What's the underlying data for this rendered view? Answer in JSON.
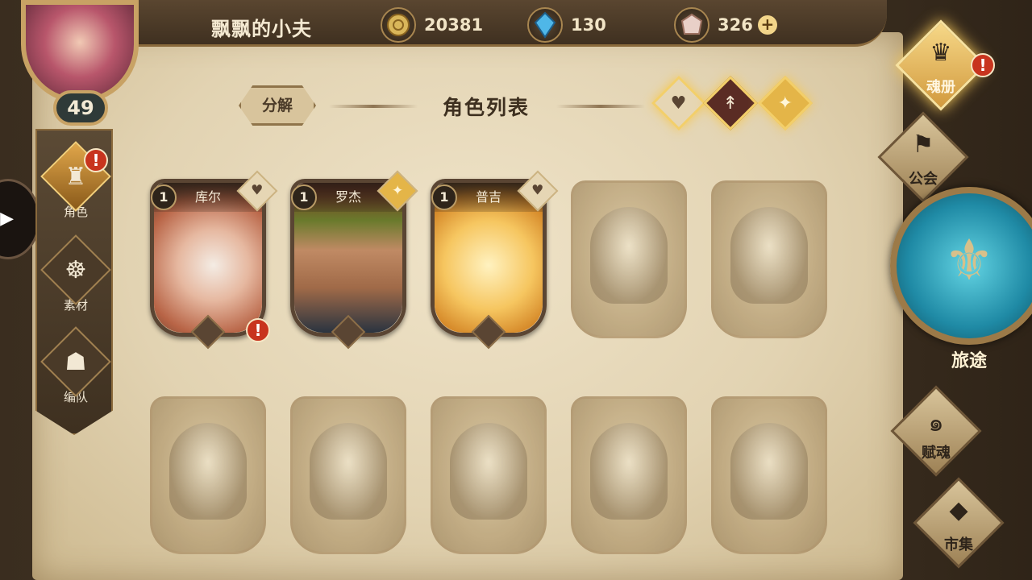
{
  "player": {
    "name": "飘飘的小夫",
    "level": "49"
  },
  "resources": [
    {
      "icon": "gold-coin-icon",
      "value": "20381",
      "has_plus": false
    },
    {
      "icon": "blue-crystal-icon",
      "value": "130",
      "has_plus": false
    },
    {
      "icon": "rainbow-gem-icon",
      "value": "326",
      "has_plus": true
    }
  ],
  "left_nav": [
    {
      "label": "角色",
      "icon": "character-helmet-icon",
      "active": true,
      "alert": true
    },
    {
      "label": "素材",
      "icon": "material-beast-icon",
      "active": false,
      "alert": false
    },
    {
      "label": "编队",
      "icon": "team-formation-icon",
      "active": false,
      "alert": false
    }
  ],
  "header": {
    "decompose_label": "分解",
    "title": "角色列表"
  },
  "filters": [
    {
      "icon": "heart-icon",
      "color": "#5a4533"
    },
    {
      "icon": "sword-icon",
      "color": "#f2e6d0"
    },
    {
      "icon": "star-shield-icon",
      "color": "#f8e8b8"
    }
  ],
  "characters_row1": [
    {
      "name": "库尔",
      "level": "1",
      "owned": true,
      "element": "heart",
      "alert": true
    },
    {
      "name": "罗杰",
      "level": "1",
      "owned": true,
      "element": "star-shield",
      "alert": false
    },
    {
      "name": "普吉",
      "level": "1",
      "owned": true,
      "element": "heart",
      "alert": false
    },
    {
      "name": "",
      "owned": false
    },
    {
      "name": "",
      "owned": false
    }
  ],
  "characters_row2": [
    {
      "name": "",
      "owned": false
    },
    {
      "name": "",
      "owned": false
    },
    {
      "name": "",
      "owned": false
    },
    {
      "name": "",
      "owned": false
    },
    {
      "name": "",
      "owned": false
    }
  ],
  "right_nav": [
    {
      "label": "魂册",
      "highlight": true,
      "alert": true
    },
    {
      "label": "公会",
      "highlight": false,
      "alert": false
    },
    {
      "label": "旅途",
      "highlight": false,
      "alert": false
    },
    {
      "label": "赋魂",
      "highlight": false,
      "alert": false
    },
    {
      "label": "市集",
      "highlight": false,
      "alert": false
    }
  ],
  "glyphs": {
    "alert": "!",
    "plus": "+",
    "play_arrow": "▶",
    "heart": "♥",
    "sword": "↟",
    "star_shield": "✦",
    "helmet": "♜",
    "beast": "☸",
    "team": "☗",
    "flag": "⚑",
    "swirl": "๑",
    "gem": "◆",
    "trident": "⚜",
    "book": "♛"
  }
}
